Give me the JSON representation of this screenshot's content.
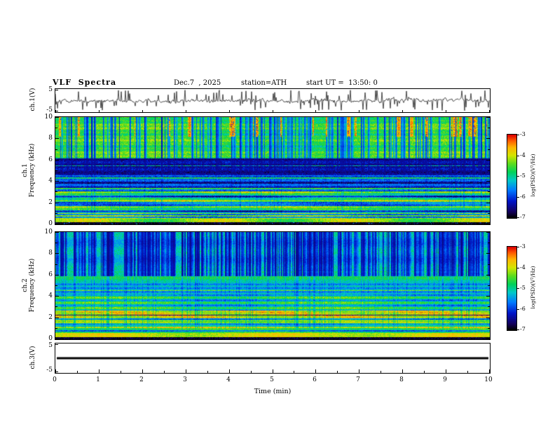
{
  "header": {
    "title": "VLF  Spectra",
    "date": "Dec.7  , 2025",
    "station": "station=ATH",
    "start_ut": "start UT =  13:50: 0"
  },
  "panels": {
    "waveform": {
      "ylabel": "ch.1(V)",
      "ymax_label": "5",
      "ymin_label": "-5"
    },
    "spec1": {
      "ylabel_line1": "ch.1",
      "ylabel_line2": "Frequency (kHz)",
      "yticks": [
        0,
        2,
        4,
        6,
        8,
        10
      ]
    },
    "spec2": {
      "ylabel_line1": "ch.2",
      "ylabel_line2": "Frequency (kHz)",
      "yticks": [
        0,
        2,
        4,
        6,
        8,
        10
      ]
    },
    "ch3": {
      "ylabel": "ch.3(V)",
      "ymax_label": "5",
      "ymin_label": "-5"
    }
  },
  "xaxis": {
    "label": "Time  (min)",
    "min": 0,
    "max": 10,
    "ticks": [
      0,
      1,
      2,
      3,
      4,
      5,
      6,
      7,
      8,
      9,
      10
    ]
  },
  "colorbars": [
    {
      "label": "log(PSD)(V²/Hz)",
      "ticks": [
        "-3",
        "-4",
        "-5",
        "-6",
        "-7"
      ],
      "zmin": -7,
      "zmax": -3
    },
    {
      "label": "log(PSD)(V²/Hz)",
      "ticks": [
        "-3",
        "-4",
        "-5",
        "-6",
        "-7"
      ],
      "zmin": -7,
      "zmax": -3
    }
  ],
  "palette": {
    "colorscale_low_to_high": [
      "#000000",
      "#14005a",
      "#0014c8",
      "#0078ff",
      "#00c8c8",
      "#00d25a",
      "#5adc1e",
      "#d2e600",
      "#ffb400",
      "#ff5a00",
      "#dc0000"
    ],
    "frame": "#000000",
    "background": "#ffffff"
  },
  "chart_data": [
    {
      "type": "line",
      "panel": "ch.1 waveform",
      "xlabel": "Time (min)",
      "x_range": [
        0,
        10
      ],
      "ylabel": "ch.1(V)",
      "y_range": [
        -5,
        5
      ],
      "description": "Noisy broadband VLF waveform fluctuating around 0 V with dense impulsive sferic spikes up and down to roughly ±4 V throughout the entire 10-minute record."
    },
    {
      "type": "heatmap",
      "panel": "ch.1 spectrogram",
      "xlabel": "Time (min)",
      "x_range": [
        0,
        10
      ],
      "ylabel": "Frequency (kHz)",
      "y_range": [
        0,
        10
      ],
      "z_label": "log(PSD)(V²/Hz)",
      "z_range": [
        -7,
        -3
      ],
      "colormap": "rainbow: black -> dark blue -> blue -> cyan -> green -> yellow -> orange -> red",
      "features": [
        "6-10 kHz: green/yellow background (~1e-5) crossed by many narrow vertical dark-blue dropouts coincident with waveform spikes",
        "occasional red high-power patches near 8.5-10 kHz",
        "4.6-6.2 kHz: dark navy low-power band (~1e-6.5) with a thin horizontal green line near 5.5 kHz",
        "3-4.6 kHz: blue band with bright green horizontal lines near 3.4 and 4.3 kHz and a darker line near 3.9 kHz",
        "0.5-3 kHz: quasi-stationary horizontal green/cyan/yellow stripes, nearly constant in time",
        "below ~0.25 kHz: black band (<= 1e-7)"
      ]
    },
    {
      "type": "heatmap",
      "panel": "ch.2 spectrogram",
      "xlabel": "Time (min)",
      "x_range": [
        0,
        10
      ],
      "ylabel": "Frequency (kHz)",
      "y_range": [
        0,
        10
      ],
      "z_label": "log(PSD)(V²/Hz)",
      "z_range": [
        -7,
        -3
      ],
      "colormap": "rainbow: black -> dark blue -> blue -> cyan -> green -> yellow -> orange -> red",
      "features": [
        "6-10 kHz: dense vertical dark-blue streaks over a cyan/green background, denser than ch.1",
        "5.3-6.4 kHz: fairly uniform green band",
        "2-2.7 kHz: bright yellow/orange band with a thin dark line near 2.3 kHz, brightness modulated slowly in time",
        "0.6-2 kHz: horizontal green/yellow stripes",
        "~0.25-0.6 kHz: bright yellow band; below 0.25 kHz black"
      ]
    },
    {
      "type": "line",
      "panel": "ch.3 waveform",
      "xlabel": "Time (min)",
      "x_range": [
        0,
        10
      ],
      "ylabel": "ch.3(V)",
      "y_range": [
        -5,
        5
      ],
      "description": "Perfectly flat thick black line at 0 V for the entire record (channel inactive)."
    }
  ]
}
